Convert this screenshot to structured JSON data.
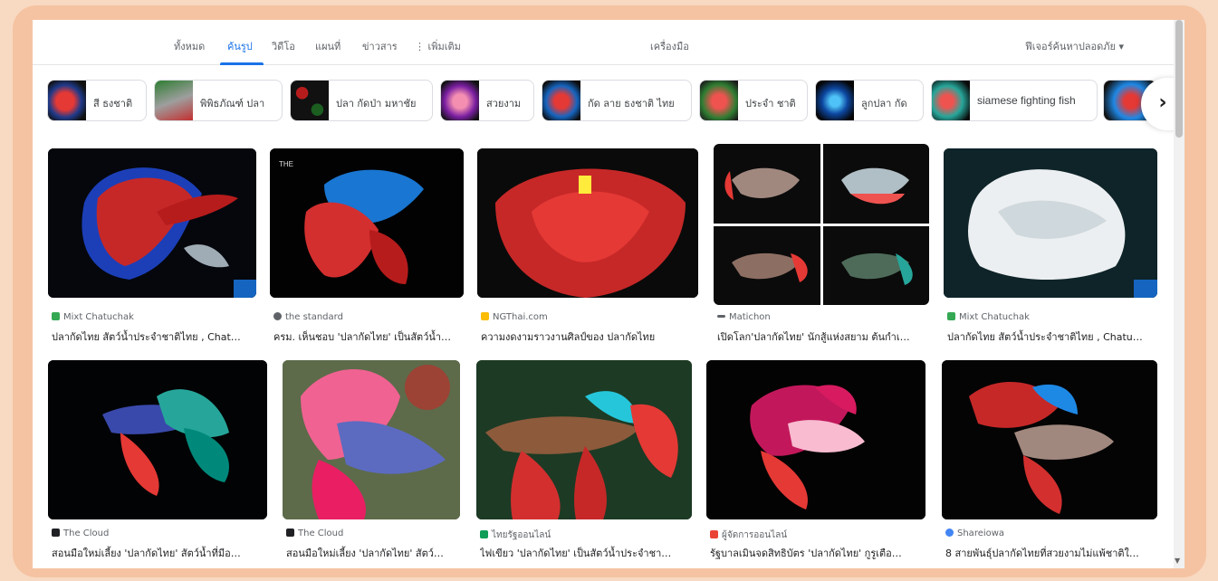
{
  "tabs": [
    {
      "label": "ทั้งหมด",
      "active": false
    },
    {
      "label": "ค้นรูป",
      "active": true
    },
    {
      "label": "วิดีโอ",
      "active": false
    },
    {
      "label": "แผนที่",
      "active": false
    },
    {
      "label": "ข่าวสาร",
      "active": false
    },
    {
      "label": "⋮ เพิ่มเติม",
      "active": false
    }
  ],
  "tools_label": "เครื่องมือ",
  "safe_search_label": "ฟีเจอร์ค้นหาปลอดภัย ▾",
  "chips": [
    {
      "label": "สี ธงชาติ"
    },
    {
      "label": "พิพิธภัณฑ์ ปลา"
    },
    {
      "label": "ปลา กัดป่า มหาชัย"
    },
    {
      "label": "สวยงาม"
    },
    {
      "label": "กัด ลาย ธงชาติ ไทย"
    },
    {
      "label": "ประจำ ชาติ"
    },
    {
      "label": "ลูกปลา กัด"
    },
    {
      "label": "siamese fighting fish"
    }
  ],
  "chip_next_icon": "chevron-right-icon",
  "results": [
    {
      "source": "Mixt Chatuchak",
      "title": "ปลากัดไทย สัตว์น้ำประจำชาติไทย , Chat…",
      "source_color": "#34a853"
    },
    {
      "source": "the standard",
      "title": "ครม. เห็นชอบ 'ปลากัดไทย' เป็นสัตว์น้ำ…",
      "source_color": "#5f6368"
    },
    {
      "source": "NGThai.com",
      "title": "ความงดงามราวงานศิลป์ของ ปลากัดไทย",
      "source_color": "#fbbc04"
    },
    {
      "source": "Matichon",
      "title": "เปิดโลก'ปลากัดไทย' นักสู้แห่งสยาม ต้นกำเ…",
      "source_color": "#5f6368"
    },
    {
      "source": "Mixt Chatuchak",
      "title": "ปลากัดไทย สัตว์น้ำประจำชาติไทย , Chatu…",
      "source_color": "#34a853"
    },
    {
      "source": "The Cloud",
      "title": "สอนมือใหม่เลี้ยง 'ปลากัดไทย' สัตว์น้ำที่มีอ…",
      "source_color": "#202124"
    },
    {
      "source": "The Cloud",
      "title": "สอนมือใหม่เลี้ยง 'ปลากัดไทย' สัตว์…",
      "source_color": "#202124"
    },
    {
      "source": "ไทยรัฐออนไลน์",
      "title": "ไฟเขียว 'ปลากัดไทย' เป็นสัตว์น้ำประจำชา…",
      "source_color": "#0f9d58"
    },
    {
      "source": "ผู้จัดการออนไลน์",
      "title": "รัฐบาลเมินจดสิทธิบัตร 'ปลากัดไทย' กูรูเตือ…",
      "source_color": "#ea4335"
    },
    {
      "source": "Shareiowa",
      "title": "8 สายพันธุ์ปลากัดไทยที่สวยงามไม่แพ้ชาติใ…",
      "source_color": "#4285f4"
    }
  ]
}
